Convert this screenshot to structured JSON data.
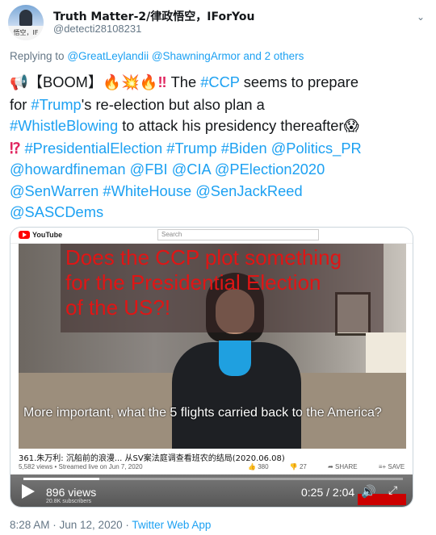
{
  "author": {
    "name": "Truth Matter-2/律政悟空，IForYou",
    "handle": "@detecti28108231",
    "avatar_caption": "悟空，IF"
  },
  "reply": {
    "prefix": "Replying to",
    "mentions": "@GreatLeylandii @ShawningArmor",
    "suffix": "and 2 others"
  },
  "tweet": {
    "emoji_megaphone": "📢",
    "boom": "【BOOM】",
    "emoji_fire": "🔥💥🔥",
    "bang": "‼",
    "t1": " The ",
    "ccp": "#CCP",
    "t2": " seems to prepare",
    "t3": "for ",
    "trump1": "#Trump",
    "t4": "'s re-election but also plan a",
    "whistle": "#WhistleBlowing",
    "t5": " to attack his presidency thereafter",
    "emoji_scream": "😱",
    "interrobang": "⁉",
    "tags_line5": "#PresidentialElection #Trump #Biden @Politics_PR",
    "tags_line6": "@howardfineman @FBI @CIA @PElection2020",
    "tags_line7": "@SenWarren #WhiteHouse @SenJackReed",
    "tags_line8": "@SASCDems"
  },
  "video": {
    "youtube_label": "YouTube",
    "search_placeholder": "Search",
    "overlay_text": "Does the CCP plot something\nfor the Presidential Election\nof the US?!",
    "caption": "More important, what the 5 flights carried back to the America?",
    "title": "361.朱万利: 沉船前的浪漫... 从SV案法庭调查看班农的结局(2020.06.08)",
    "meta": "5,582 views • Streamed live on Jun 7, 2020",
    "likes": "380",
    "dislikes": "27",
    "share": "SHARE",
    "save": "SAVE",
    "views": "896 views",
    "subscribers": "20.8K subscribers",
    "time": "0:25 / 2:04",
    "progress": 0.2
  },
  "footer": {
    "datetime": "8:28 AM · Jun 12, 2020 · ",
    "app": "Twitter Web App"
  }
}
